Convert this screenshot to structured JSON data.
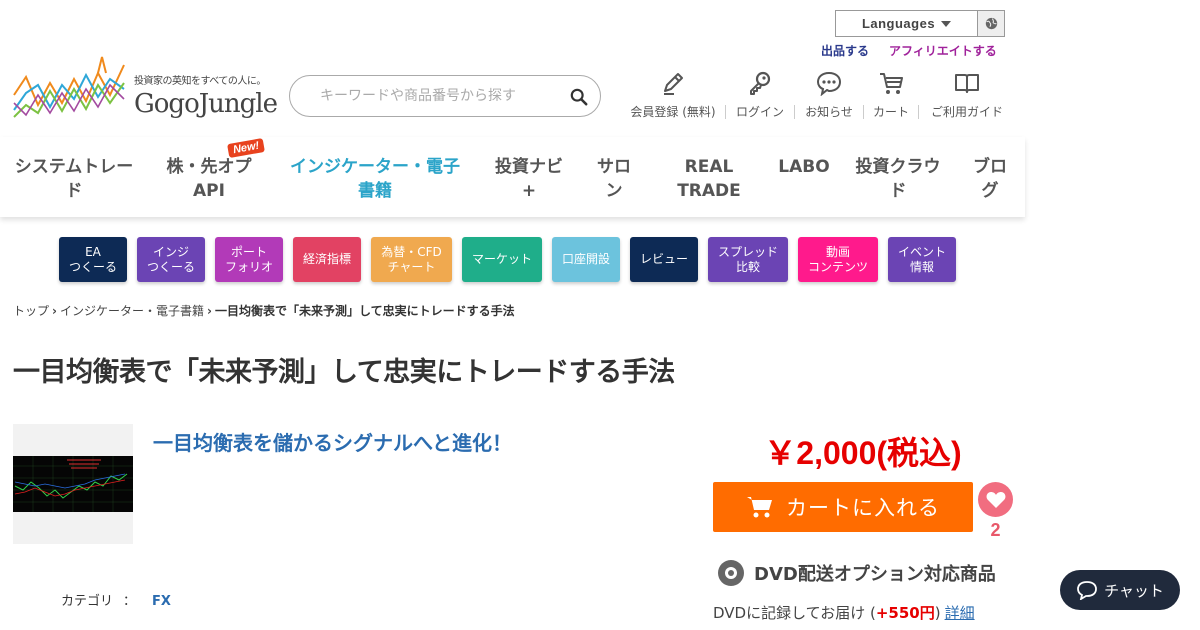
{
  "top_links": {
    "languages_label": "Languages",
    "listing": "出品する",
    "affiliate": "アフィリエイトする"
  },
  "logo": {
    "tagline": "投資家の英知をすべての人に。",
    "name": "GogoJungle"
  },
  "search": {
    "placeholder": "キーワードや商品番号から探す"
  },
  "header_icons": [
    {
      "icon": "pencil-icon",
      "label": "会員登録 (無料)"
    },
    {
      "icon": "key-icon",
      "label": "ログイン"
    },
    {
      "icon": "speech-bubble-icon",
      "label": "お知らせ"
    },
    {
      "icon": "cart-icon",
      "label": "カート"
    },
    {
      "icon": "book-icon",
      "label": "ご利用ガイド"
    }
  ],
  "main_nav": [
    {
      "line1": "システムトレー",
      "line2": "ド"
    },
    {
      "line1": "株・先オプ",
      "line2": "API",
      "badge": "New!"
    },
    {
      "line1": "インジケーター・電子",
      "line2": "書籍",
      "active": true
    },
    {
      "line1": "投資ナビ",
      "line2": "+"
    },
    {
      "line1": "サロ",
      "line2": "ン"
    },
    {
      "line1": "REAL",
      "line2": "TRADE"
    },
    {
      "line1": "LABO",
      "line2": ""
    },
    {
      "line1": "投資クラウ",
      "line2": "ド"
    },
    {
      "line1": "ブロ",
      "line2": "グ"
    }
  ],
  "categories": [
    {
      "label": "EA\nつくーる",
      "color": "#0d2a55"
    },
    {
      "label": "インジ\nつくーる",
      "color": "#6b44b4"
    },
    {
      "label": "ポート\nフォリオ",
      "color": "#b23ab8"
    },
    {
      "label": "経済指標",
      "color": "#e24263"
    },
    {
      "label": "為替・CFD\nチャート",
      "color": "#f0a94f"
    },
    {
      "label": "マーケット",
      "color": "#1fae8a"
    },
    {
      "label": "口座開設",
      "color": "#6cc3dd"
    },
    {
      "label": "レビュー",
      "color": "#0d2a55"
    },
    {
      "label": "スプレッド\n比較",
      "color": "#6b44b4"
    },
    {
      "label": "動画\nコンテンツ",
      "color": "#ff1a8c"
    },
    {
      "label": "イベント\n情報",
      "color": "#6b44b4"
    }
  ],
  "breadcrumb": {
    "home": "トップ",
    "section": "インジケーター・電子書籍",
    "current": "一目均衡表で「未来予測」して忠実にトレードする手法"
  },
  "product": {
    "title": "一目均衡表で「未来予測」して忠実にトレードする手法",
    "subtitle": "一目均衡表を儲かるシグナルへと進化！",
    "category_label": "カテゴリ",
    "category_colon": "：",
    "category_value": "FX",
    "price": "￥2,000(税込)",
    "cart_label": "カートに入れる",
    "favorite_count": "2",
    "dvd_label": "DVD配送オプション対応商品",
    "dvd_note_prefix": "DVDに記録してお届け (",
    "dvd_fee": "+550円",
    "dvd_note_suffix": ")",
    "dvd_detail_link": "詳細"
  },
  "chat": {
    "label": "チャット"
  },
  "colors": {
    "accent_blue": "#2ba4c9",
    "price_red": "#e60000",
    "cart_orange": "#ff6c00",
    "chat_bg": "#202a3c"
  }
}
